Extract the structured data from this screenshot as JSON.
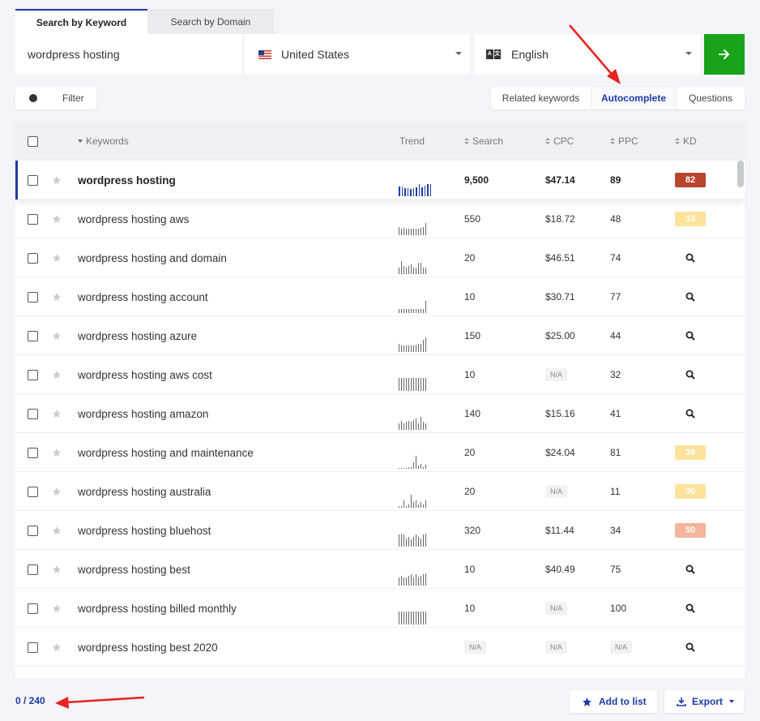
{
  "tabs": [
    {
      "label": "Search by Keyword",
      "active": true
    },
    {
      "label": "Search by Domain",
      "active": false
    }
  ],
  "search": {
    "keyword_value": "wordpress hosting",
    "country": "United States",
    "country_icon": "us-flag-icon",
    "language": "English",
    "language_icon": "translate-icon",
    "go_icon": "arrow-right-icon",
    "go_color": "#18a31b"
  },
  "filter": {
    "label": "Filter",
    "enabled": false
  },
  "modes": [
    {
      "label": "Related keywords",
      "active": false
    },
    {
      "label": "Autocomplete",
      "active": true
    },
    {
      "label": "Questions",
      "active": false
    }
  ],
  "table": {
    "columns": {
      "keywords": "Keywords",
      "trend": "Trend",
      "search": "Search",
      "cpc": "CPC",
      "ppc": "PPC",
      "kd": "KD"
    },
    "rows": [
      {
        "keyword": "wordpress hosting",
        "search": "9,500",
        "cpc": "$47.14",
        "ppc": "89",
        "kd": "82",
        "kd_color": "#b7442b",
        "trend": [
          12,
          12,
          10,
          10,
          9,
          10,
          11,
          15,
          11,
          13,
          15,
          15
        ],
        "active": true
      },
      {
        "keyword": "wordpress hosting aws",
        "search": "550",
        "cpc": "$18.72",
        "ppc": "48",
        "kd": "33",
        "kd_color": "#fde29a",
        "trend": [
          10,
          8,
          9,
          8,
          8,
          8,
          8,
          8,
          8,
          9,
          10,
          15
        ]
      },
      {
        "keyword": "wordpress hosting and domain",
        "search": "20",
        "cpc": "$46.51",
        "ppc": "74",
        "kd": "",
        "kd_color": "",
        "trend": [
          8,
          16,
          10,
          8,
          10,
          12,
          8,
          8,
          14,
          14,
          8,
          8
        ]
      },
      {
        "keyword": "wordpress hosting account",
        "search": "10",
        "cpc": "$30.71",
        "ppc": "77",
        "kd": "",
        "kd_color": "",
        "trend": [
          5,
          5,
          5,
          5,
          5,
          5,
          5,
          5,
          5,
          5,
          5,
          15
        ]
      },
      {
        "keyword": "wordpress hosting azure",
        "search": "150",
        "cpc": "$25.00",
        "ppc": "44",
        "kd": "",
        "kd_color": "",
        "trend": [
          10,
          8,
          8,
          8,
          8,
          8,
          8,
          9,
          10,
          10,
          15,
          18
        ]
      },
      {
        "keyword": "wordpress hosting aws cost",
        "search": "10",
        "cpc": "N/A",
        "ppc": "32",
        "kd": "",
        "kd_color": "",
        "trend": [
          16,
          16,
          16,
          16,
          16,
          16,
          16,
          16,
          16,
          16,
          16,
          16
        ]
      },
      {
        "keyword": "wordpress hosting amazon",
        "search": "140",
        "cpc": "$15.16",
        "ppc": "41",
        "kd": "",
        "kd_color": "",
        "trend": [
          8,
          11,
          8,
          10,
          11,
          10,
          12,
          14,
          8,
          16,
          10,
          8
        ]
      },
      {
        "keyword": "wordpress hosting and maintenance",
        "search": "20",
        "cpc": "$24.04",
        "ppc": "81",
        "kd": "38",
        "kd_color": "#fde29a",
        "trend": [
          1,
          1,
          1,
          1,
          2,
          2,
          8,
          16,
          4,
          6,
          2,
          5
        ]
      },
      {
        "keyword": "wordpress hosting australia",
        "search": "20",
        "cpc": "N/A",
        "ppc": "11",
        "kd": "30",
        "kd_color": "#fde29a",
        "trend": [
          2,
          2,
          9,
          2,
          4,
          16,
          7,
          9,
          4,
          7,
          4,
          9
        ]
      },
      {
        "keyword": "wordpress hosting bluehost",
        "search": "320",
        "cpc": "$11.44",
        "ppc": "34",
        "kd": "50",
        "kd_color": "#f5b49b",
        "trend": [
          15,
          16,
          15,
          10,
          12,
          9,
          12,
          15,
          12,
          10,
          15,
          16
        ]
      },
      {
        "keyword": "wordpress hosting best",
        "search": "10",
        "cpc": "$40.49",
        "ppc": "75",
        "kd": "",
        "kd_color": "",
        "trend": [
          10,
          12,
          10,
          10,
          12,
          14,
          10,
          14,
          10,
          12,
          14,
          15
        ]
      },
      {
        "keyword": "wordpress hosting billed monthly",
        "search": "10",
        "cpc": "N/A",
        "ppc": "100",
        "kd": "",
        "kd_color": "",
        "trend": [
          16,
          16,
          16,
          16,
          16,
          16,
          16,
          16,
          16,
          16,
          16,
          16
        ]
      },
      {
        "keyword": "wordpress hosting best 2020",
        "search": "N/A",
        "cpc": "N/A",
        "ppc": "N/A",
        "kd": "",
        "kd_color": "",
        "trend": []
      }
    ]
  },
  "footer": {
    "count": "0 / 240",
    "add_label": "Add to list",
    "export_label": "Export"
  },
  "annotation_color": "#e8231f"
}
